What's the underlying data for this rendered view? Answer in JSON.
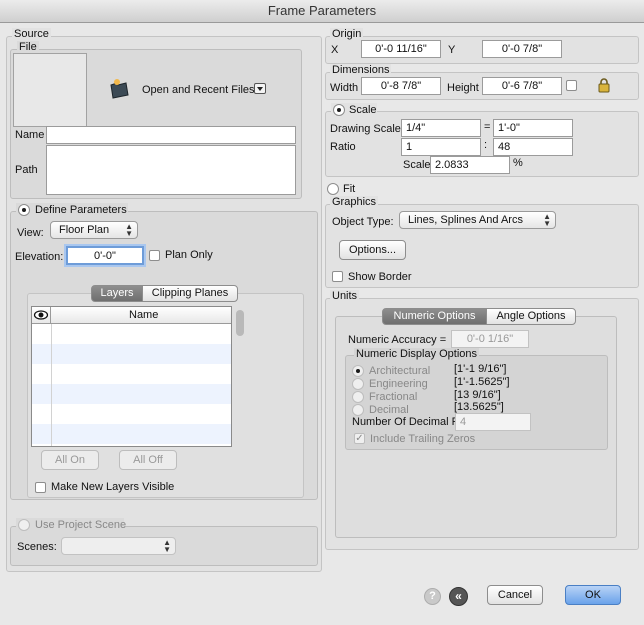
{
  "window": {
    "title": "Frame Parameters"
  },
  "source": {
    "group_label": "Source",
    "file_label": "File",
    "open_recent_label": "Open and Recent Files",
    "name_label": "Name",
    "name_value": "",
    "path_label": "Path",
    "path_value": ""
  },
  "define": {
    "label": "Define Parameters",
    "view_label": "View:",
    "view_value": "Floor Plan",
    "elevation_label": "Elevation:",
    "elevation_value": "0'-0\"",
    "plan_only_label": "Plan Only",
    "tabs": {
      "layers": "Layers",
      "clipping": "Clipping Planes"
    },
    "table_header_name": "Name",
    "all_on": "All On",
    "all_off": "All Off",
    "make_visible_label": "Make New Layers Visible"
  },
  "project_scene": {
    "label": "Use Project Scene",
    "scenes_label": "Scenes:",
    "scenes_value": ""
  },
  "origin": {
    "label": "Origin",
    "x_label": "X",
    "x_value": "0'-0 11/16\"",
    "y_label": "Y",
    "y_value": "0'-0 7/8\""
  },
  "dimensions": {
    "label": "Dimensions",
    "width_label": "Width",
    "width_value": "0'-8 7/8\"",
    "height_label": "Height",
    "height_value": "0'-6 7/8\""
  },
  "scale": {
    "label": "Scale",
    "drawing_scale_label": "Drawing Scale",
    "drawing_scale_value": "1/4\"",
    "equals": "=",
    "drawing_scale_right": "1'-0\"",
    "ratio_label": "Ratio",
    "ratio_left": "1",
    "colon": ":",
    "ratio_right": "48",
    "scale_label": "Scale",
    "scale_value": "2.0833",
    "percent": "%"
  },
  "fit": {
    "label": "Fit"
  },
  "graphics": {
    "label": "Graphics",
    "object_type_label": "Object Type:",
    "object_type_value": "Lines, Splines And Arcs",
    "options_button": "Options...",
    "show_border_label": "Show Border"
  },
  "units": {
    "label": "Units",
    "tabs": {
      "numeric": "Numeric Options",
      "angle": "Angle Options"
    },
    "accuracy_label": "Numeric Accuracy =",
    "accuracy_value": "0'-0 1/16\"",
    "display_options_label": "Numeric Display Options",
    "options": [
      {
        "label": "Architectural",
        "example": "[1'-1 9/16\"]"
      },
      {
        "label": "Engineering",
        "example": "[1'-1.5625\"]"
      },
      {
        "label": "Fractional",
        "example": "[13 9/16\"]"
      },
      {
        "label": "Decimal",
        "example": "[13.5625\"]"
      }
    ],
    "decimal_places_label": "Number Of Decimal Places",
    "decimal_places_value": "4",
    "trailing_zeros_label": "Include Trailing Zeros"
  },
  "footer": {
    "help_icon": "?",
    "back_icon": "«",
    "cancel": "Cancel",
    "ok": "OK"
  }
}
